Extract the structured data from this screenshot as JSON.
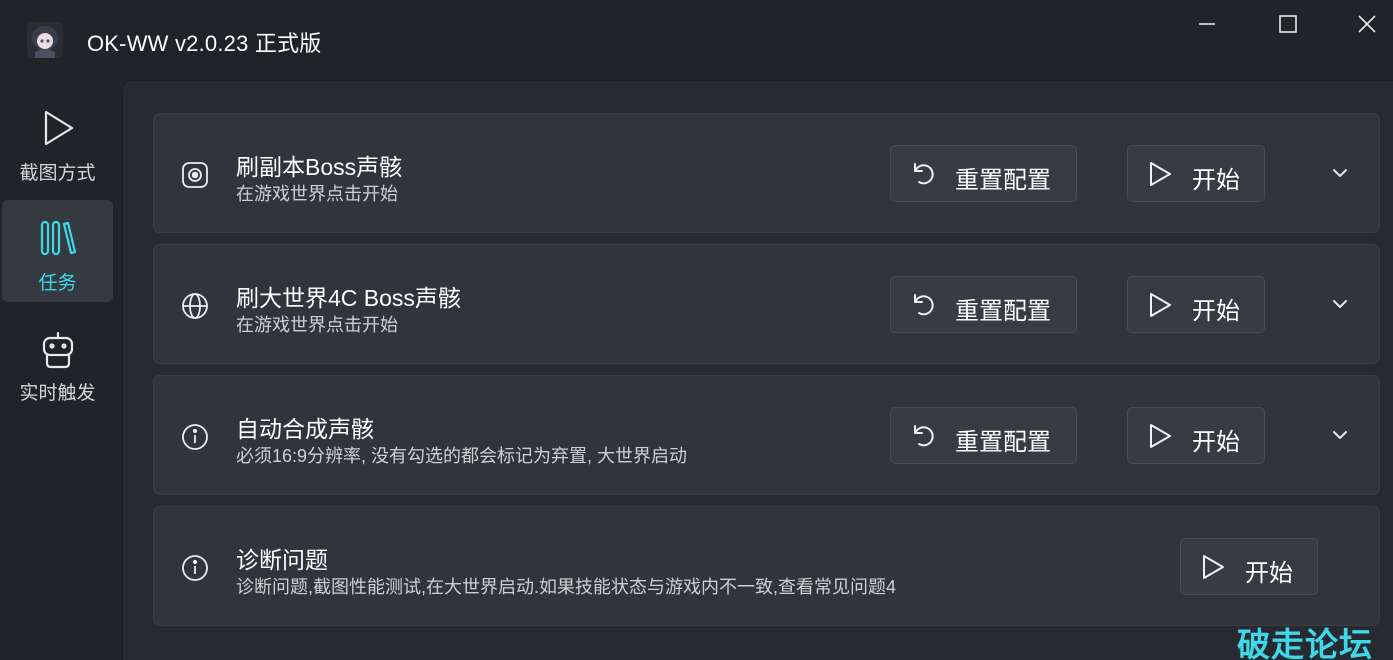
{
  "window": {
    "title": "OK-WW v2.0.23 正式版",
    "controls": [
      "minimize-icon",
      "maximize-icon",
      "close-icon"
    ]
  },
  "sidebar": {
    "items": [
      {
        "label": "截图方式",
        "icon": "play-outline-icon",
        "selected": false
      },
      {
        "label": "任务",
        "icon": "library-icon",
        "selected": true
      },
      {
        "label": "实时触发",
        "icon": "robot-icon",
        "selected": false
      }
    ]
  },
  "tasks": [
    {
      "title": "刷副本Boss声骸",
      "description": "在游戏世界点击开始",
      "icon": "target-icon",
      "reset_label": "重置配置",
      "start_label": "开始"
    },
    {
      "title": "刷大世界4C Boss声骸",
      "description": "在游戏世界点击开始",
      "icon": "globe-icon",
      "reset_label": "重置配置",
      "start_label": "开始"
    },
    {
      "title": "自动合成声骸",
      "description": "必须16:9分辨率, 没有勾选的都会标记为弃置, 大世界启动",
      "icon": "info-icon",
      "reset_label": "重置配置",
      "start_label": "开始"
    },
    {
      "title": "诊断问题",
      "description": "诊断问题,截图性能测试,在大世界启动.如果技能状态与游戏内不一致,查看常见问题4",
      "icon": "info-icon",
      "start_label": "开始"
    }
  ],
  "watermark": "破走论坛",
  "colors": {
    "accent": "#3fd8e8",
    "window_bg": "#202429",
    "content_bg": "#272b31",
    "card_bg": "#30353c",
    "button_bg": "#373c43"
  }
}
